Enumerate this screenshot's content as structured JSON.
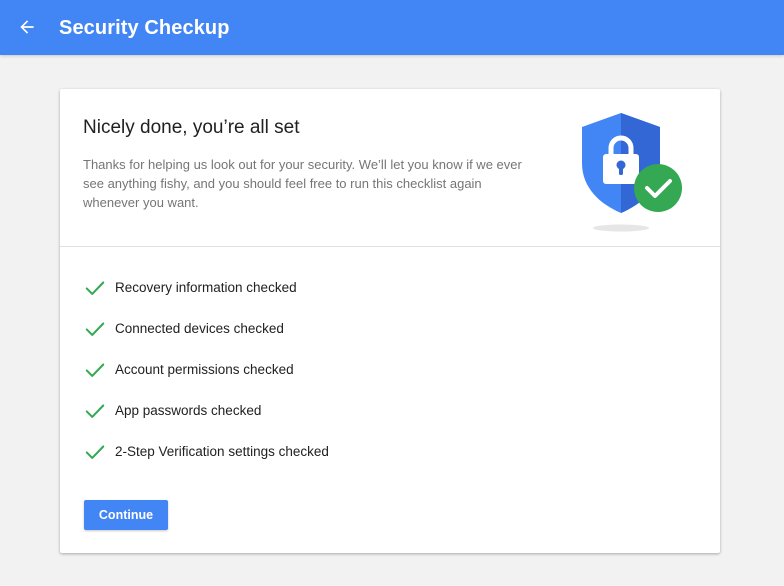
{
  "header": {
    "title": "Security Checkup",
    "back_icon": "arrow-back-icon"
  },
  "card": {
    "heading": "Nicely done, you’re all set",
    "description": "Thanks for helping us look out for your security. We’ll let you know if we ever see anything fishy, and you should feel free to run this checklist again whenever you want.",
    "illustration_icon": "shield-lock-check-icon"
  },
  "checklist": [
    {
      "label": "Recovery information checked",
      "icon": "check-icon"
    },
    {
      "label": "Connected devices checked",
      "icon": "check-icon"
    },
    {
      "label": "Account permissions checked",
      "icon": "check-icon"
    },
    {
      "label": "App passwords checked",
      "icon": "check-icon"
    },
    {
      "label": "2-Step Verification settings checked",
      "icon": "check-icon"
    }
  ],
  "actions": {
    "continue_label": "Continue"
  },
  "colors": {
    "primary": "#4285f4",
    "check_green": "#34a853",
    "shield_dark": "#3367d6",
    "background": "#f2f2f2"
  }
}
